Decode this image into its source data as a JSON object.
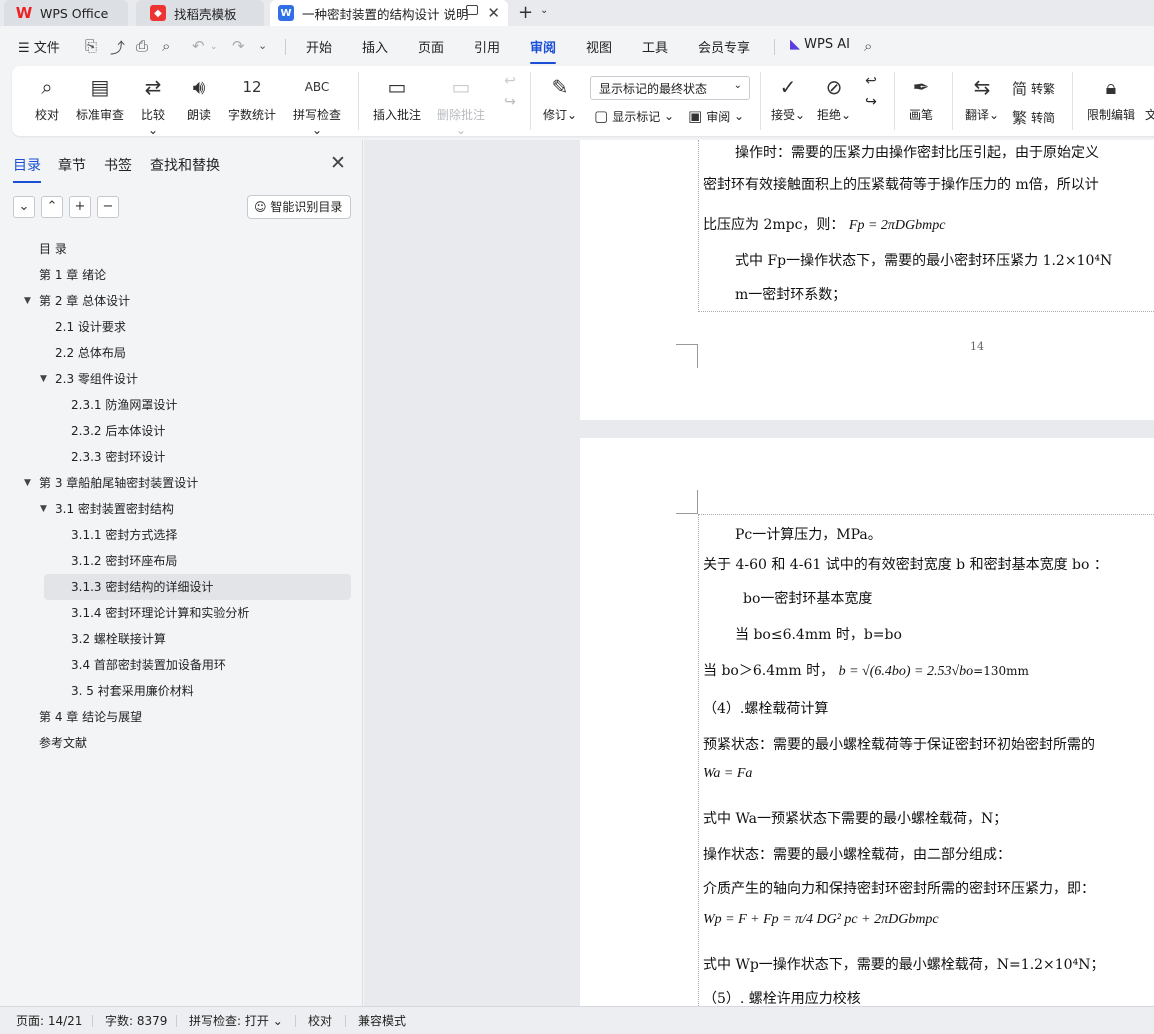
{
  "tabs": [
    {
      "label": "WPS Office"
    },
    {
      "label": "找稻壳模板"
    },
    {
      "label": "一种密封装置的结构设计 说明"
    }
  ],
  "menubar": {
    "file": "文件",
    "items": [
      "开始",
      "插入",
      "页面",
      "引用",
      "审阅",
      "视图",
      "工具",
      "会员专享"
    ],
    "active": "审阅",
    "wps_ai": "WPS AI"
  },
  "ribbon": {
    "proofread": "校对",
    "standard_review": "标准审查",
    "compare": "比较",
    "read_aloud": "朗读",
    "word_count": "字数统计",
    "word_count_icon": "12",
    "spell_check": "拼写检查",
    "spell_icon": "ABC",
    "insert_comment": "插入批注",
    "delete_comment": "删除批注",
    "revise": "修订",
    "display_mode": "显示标记的最终状态",
    "show_marks": "显示标记",
    "review": "审阅",
    "accept": "接受",
    "reject": "拒绝",
    "brush": "画笔",
    "translate": "翻译",
    "to_traditional": "转繁",
    "to_traditional_icon": "简",
    "to_simplified": "转简",
    "to_simplified_icon": "繁",
    "restrict_edit": "限制编辑",
    "restrict_edit_next": "文"
  },
  "sidebar": {
    "tabs": [
      "目录",
      "章节",
      "书签",
      "查找和替换"
    ],
    "active_tab": "目录",
    "ai_toc": "智能识别目录",
    "toc": [
      {
        "label": "目  录",
        "level": 0,
        "expanded": null
      },
      {
        "label": "第 1 章  绪论",
        "level": 0,
        "expanded": null
      },
      {
        "label": "第 2 章  总体设计",
        "level": 0,
        "expanded": true
      },
      {
        "label": "2.1  设计要求",
        "level": 1,
        "expanded": null
      },
      {
        "label": "2.2    总体布局",
        "level": 1,
        "expanded": null
      },
      {
        "label": "2.3    零组件设计",
        "level": 1,
        "expanded": true
      },
      {
        "label": "2.3.1 防渔网罩设计",
        "level": 2,
        "expanded": null
      },
      {
        "label": "2.3.2 后本体设计",
        "level": 2,
        "expanded": null
      },
      {
        "label": "2.3.3 密封环设计",
        "level": 2,
        "expanded": null
      },
      {
        "label": "第 3 章船舶尾轴密封装置设计",
        "level": 0,
        "expanded": true
      },
      {
        "label": "3.1  密封装置密封结构",
        "level": 1,
        "expanded": true
      },
      {
        "label": "3.1.1 密封方式选择",
        "level": 2,
        "expanded": null
      },
      {
        "label": "3.1.2 密封环座布局",
        "level": 2,
        "expanded": null
      },
      {
        "label": "3.1.3 密封结构的详细设计",
        "level": 2,
        "expanded": null,
        "selected": true
      },
      {
        "label": "3.1.4 密封环理论计算和实验分析",
        "level": 2,
        "expanded": null
      },
      {
        "label": "3.2 螺栓联接计算",
        "level": 2,
        "expanded": null
      },
      {
        "label": "3.4 首部密封装置加设备用环",
        "level": 2,
        "expanded": null
      },
      {
        "label": "3. 5 衬套采用廉价材料",
        "level": 2,
        "expanded": null
      },
      {
        "label": "第 4 章  结论与展望",
        "level": 0,
        "expanded": null
      },
      {
        "label": "参考文献",
        "level": 0,
        "expanded": null
      }
    ]
  },
  "document": {
    "page1": {
      "lines": [
        "操作时：需要的压紧力由操作密封比压引起，由于原始定义",
        "密封环有效接触面积上的压紧载荷等于操作压力的 m倍，所以计",
        "比压应为 2mpc，则：",
        "式中 Fp一操作状态下，需要的最小密封环压紧力 1.2×10⁴N",
        "m一密封环系数；"
      ],
      "formula": "Fp = 2πDGbmpc",
      "page_number": "14"
    },
    "page2": {
      "lines": [
        "Pc一计算压力，MPa。",
        "关于 4-60 和 4-61 试中的有效密封宽度 b 和密封基本宽度 bo ：",
        "bo一密封环基本宽度",
        "当 bo≤6.4mm 时，b=bo",
        "当 bo＞6.4mm 时，",
        "（4）.螺栓载荷计算",
        "预紧状态：需要的最小螺栓载荷等于保证密封环初始密封所需的",
        "式中  Wa一预紧状态下需要的最小螺栓载荷，N；",
        "操作状态：需要的最小螺栓载荷，由二部分组成：",
        "介质产生的轴向力和保持密封环密封所需的密封环压紧力，即：",
        "式中  Wp一操作状态下，需要的最小螺栓载荷，N=1.2×10⁴N；",
        "（5）. 螺栓许用应力校核"
      ],
      "formula_b": "b = √(6.4bo) = 2.53√bo",
      "formula_b_result": "=130mm",
      "formula_wa": "Wa = Fa",
      "formula_wp": "Wp = F + Fp = π/4 DG² pc + 2πDGbmpc"
    }
  },
  "statusbar": {
    "page": "页面: 14/21",
    "words": "字数: 8379",
    "spell": "拼写检查: 打开",
    "proof": "校对",
    "compat": "兼容模式"
  },
  "colors": {
    "accent": "#1a4fd6",
    "wps_red": "#e22222",
    "doc_blue": "#2f6fe8"
  }
}
